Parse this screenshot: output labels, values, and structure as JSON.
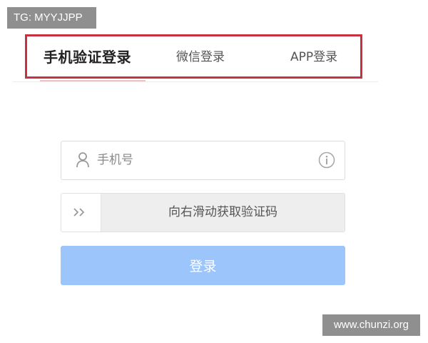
{
  "overlay": {
    "tg_label": "TG: MYYJJPP",
    "watermark": "www.chunzi.org",
    "highlight_color": "#c9313c"
  },
  "tabs": [
    {
      "label": "手机验证登录",
      "active": true
    },
    {
      "label": "微信登录",
      "active": false
    },
    {
      "label": "APP登录",
      "active": false
    }
  ],
  "form": {
    "phone_placeholder": "手机号",
    "phone_value": "",
    "user_icon": "user-icon",
    "info_icon": "info-icon",
    "slider_text": "向右滑动获取验证码",
    "slider_handle_glyph": ">>",
    "login_label": "登录",
    "login_color": "#9cc5fb"
  }
}
